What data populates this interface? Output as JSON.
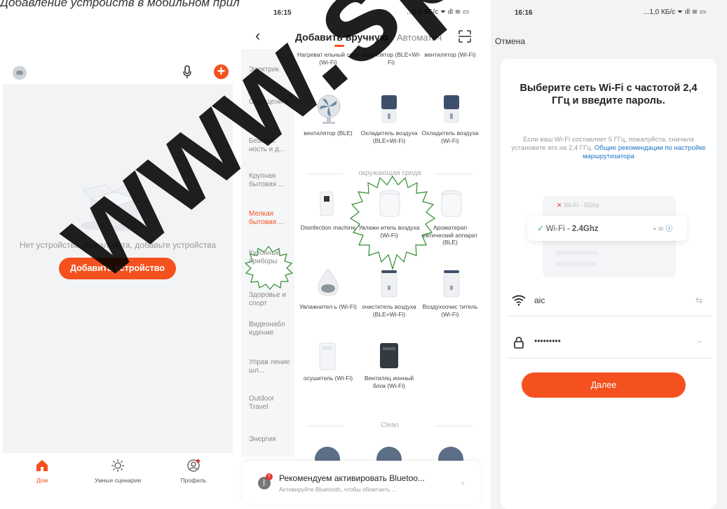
{
  "caption": "Добавление устройств в мобильном приложении",
  "watermark": "www.sp",
  "colors": {
    "accent": "#f4511e",
    "link": "#1a73c8",
    "highlight_outline": "#2e8b2e"
  },
  "screen1": {
    "empty_text": "Нет устройства, пожалуйста, добавьте устройства",
    "add_device_button": "Добавить устройство",
    "nav": [
      {
        "label": "Дом",
        "icon": "home-icon",
        "active": true
      },
      {
        "label": "Умные сценарии",
        "icon": "sun-icon",
        "active": false
      },
      {
        "label": "Профиль",
        "icon": "profile-icon",
        "active": false
      }
    ]
  },
  "screen2": {
    "status": {
      "time": "16:15",
      "right": "...0,0 КБ/с"
    },
    "tabs": {
      "manual": "Добавить вручную",
      "auto": "Автоматич"
    },
    "categories": [
      {
        "label": "Электрик",
        "active": false
      },
      {
        "label": "Освещени е",
        "active": false
      },
      {
        "label": "Безопас ность и д...",
        "active": false
      },
      {
        "label": "Крупная бытовая ...",
        "active": false
      },
      {
        "label": "Мелкая бытовая ...",
        "active": true
      },
      {
        "label": "Кухонные приборы",
        "active": false
      },
      {
        "label": "Здоровье и спорт",
        "active": false
      },
      {
        "label": "Видеонабл юдение",
        "active": false
      },
      {
        "label": "Управ ление шл...",
        "active": false
      },
      {
        "label": "Outdoor Travel",
        "active": false
      },
      {
        "label": "Энергия",
        "active": false
      }
    ],
    "top_row": [
      "Нагреват ельный стол (Wi-Fi)",
      "вентилятор (BLE+Wi-Fi)",
      "вентилятор (Wi-Fi)"
    ],
    "row2": [
      "вентилятор (BLE)",
      "Охладитель воздуха (BLE+Wi-Fi)",
      "Охладитель воздуха (Wi-Fi)"
    ],
    "section_env": "окружающая среда",
    "row3": [
      "Disinfection machine",
      "Увлажн итель воздуха (Wi-Fi)",
      "Ароматерап евтический аппарат (BLE)"
    ],
    "row4": [
      "Увлажнител ь (Wi-Fi)",
      "очиститель воздуха (BLE+Wi-Fi)",
      "Воздухоочис титель (Wi-Fi)"
    ],
    "row5": [
      "осушитель (Wi-Fi)",
      "Вентиляц ионный блок (Wi-Fi)"
    ],
    "section_clean": "Clean",
    "banner": {
      "badge": "!",
      "title": "Рекомендуем активировать Bluetoo...",
      "subtitle": "Активируйте Bluetooth, чтобы облегчить ..."
    }
  },
  "screen3": {
    "status": {
      "time": "16:16",
      "right": "...1,0 КБ/с"
    },
    "cancel": "Отмена",
    "title": "Выберите сеть Wi-Fi с частотой 2,4 ГГц и введите пароль.",
    "desc": "Если ваш Wi-Fi составляет 5 ГГц, пожалуйста, сначала установите его на 2,4 ГГц.",
    "desc_link": "Общие рекомендации по настройке маршрутизатора",
    "wifi_5": "Wi-Fi - 5Ghz",
    "wifi_24_prefix": "Wi-Fi - ",
    "wifi_24_band": "2.4Ghz",
    "ssid": "aic",
    "password": "•••••••••",
    "next_button": "Далее"
  }
}
